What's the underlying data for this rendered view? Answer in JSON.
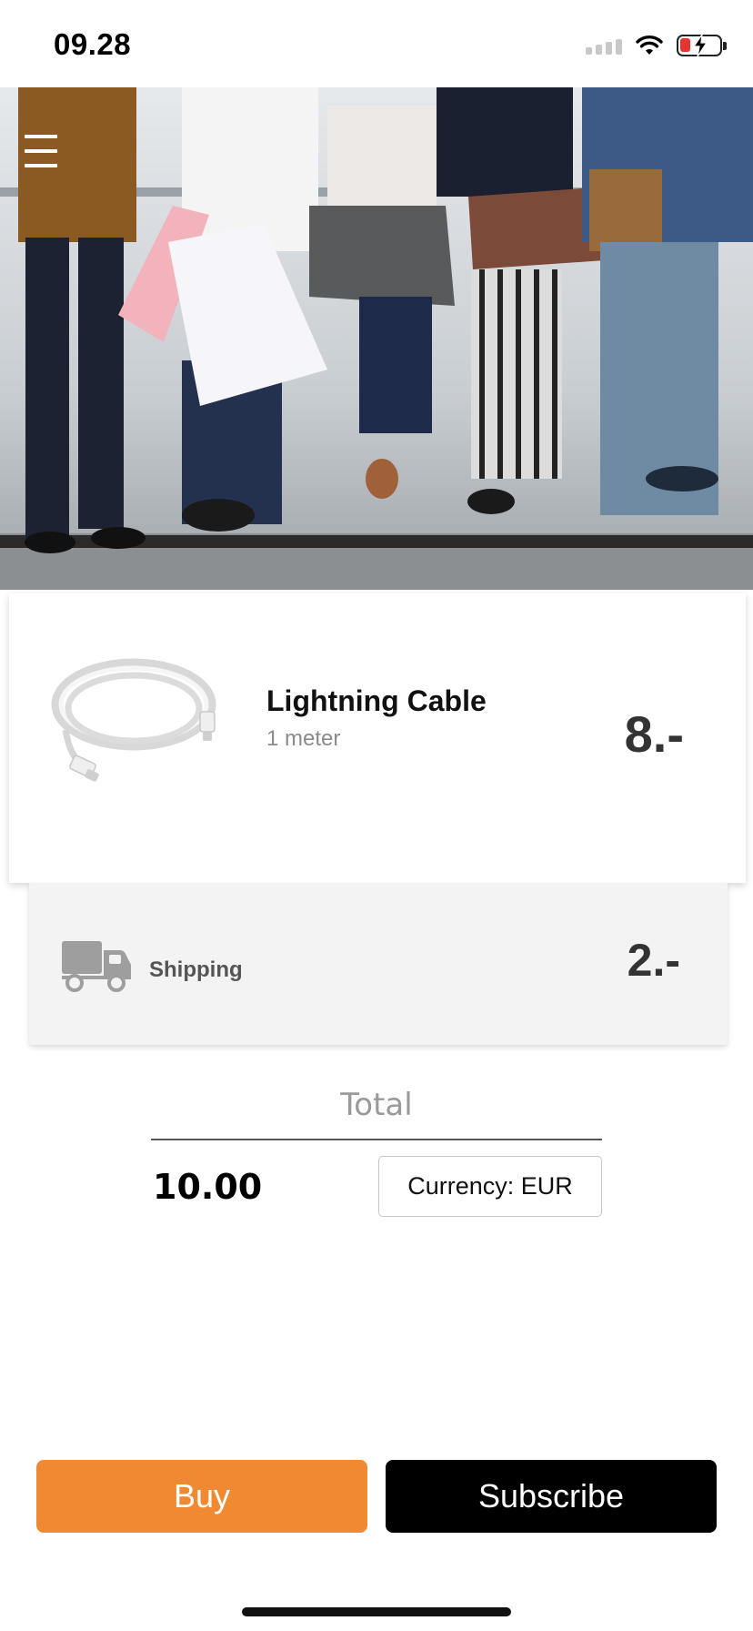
{
  "status_bar": {
    "time": "09.28",
    "icons": [
      "signal-icon",
      "wifi-icon",
      "battery-charging-icon"
    ],
    "battery_color": "#e8342f"
  },
  "hero": {
    "image": "shoppers-with-bags-photo",
    "menu_icon": "hamburger-menu-icon"
  },
  "product": {
    "image": "lightning-cable-image",
    "name": "Lightning Cable",
    "variant": "1 meter",
    "price": "8.-"
  },
  "shipping": {
    "icon": "truck-icon",
    "label": "Shipping",
    "price": "2.-"
  },
  "total": {
    "label": "Total",
    "amount": "10.00",
    "currency_label": "Currency: EUR"
  },
  "actions": {
    "buy_label": "Buy",
    "subscribe_label": "Subscribe",
    "buy_color": "#ef8a32",
    "subscribe_color": "#000000"
  }
}
